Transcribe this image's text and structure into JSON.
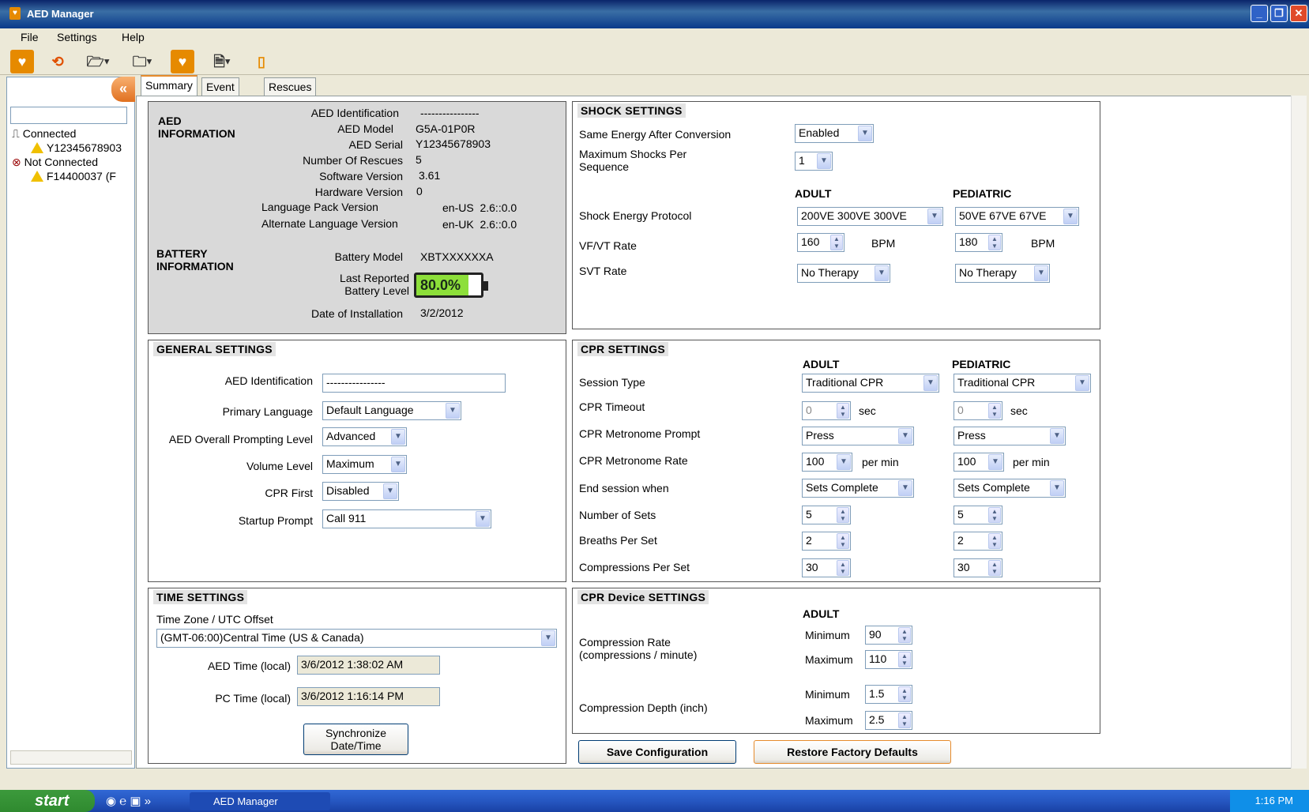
{
  "window": {
    "title": "AED Manager"
  },
  "menu": [
    "File",
    "Settings",
    "Help"
  ],
  "tree": {
    "connected_label": "Connected",
    "connected_device": "Y12345678903",
    "not_connected_label": "Not Connected",
    "not_connected_device": "F14400037 (F"
  },
  "tabs": [
    "Summary",
    "Event Log",
    "Rescues"
  ],
  "aed_info": {
    "title": "AED INFORMATION",
    "identification_label": "AED Identification",
    "identification": "----------------",
    "model_label": "AED Model",
    "model": "G5A-01P0R",
    "serial_label": "AED Serial",
    "serial": "Y12345678903",
    "rescues_label": "Number Of Rescues",
    "rescues": "5",
    "software_label": "Software Version",
    "software": "3.61",
    "hardware_label": "Hardware Version",
    "hardware": "0",
    "langpack_label": "Language Pack Version",
    "langpack": "en-US  2.6::0.0",
    "altlang_label": "Alternate Language Version",
    "altlang": "en-UK  2.6::0.0"
  },
  "battery": {
    "title": "BATTERY INFORMATION",
    "model_label": "Battery Model",
    "model": "XBTXXXXXXA",
    "level_label": "Last Reported Battery Level",
    "level_text": "80.0%",
    "level_fraction": 0.8,
    "install_label": "Date of Installation",
    "install": "3/2/2012"
  },
  "general": {
    "title": "GENERAL SETTINGS",
    "aed_id_label": "AED Identification",
    "aed_id": "----------------",
    "language_label": "Primary Language",
    "language": "Default Language",
    "prompting_label": "AED Overall Prompting Level",
    "prompting": "Advanced",
    "volume_label": "Volume Level",
    "volume": "Maximum",
    "cpr_first_label": "CPR First",
    "cpr_first": "Disabled",
    "startup_label": "Startup Prompt",
    "startup": "Call 911"
  },
  "time": {
    "title": "TIME SETTINGS",
    "tz_label": "Time Zone / UTC Offset",
    "tz": "(GMT-06:00)Central Time (US & Canada)",
    "aed_time_label": "AED Time (local)",
    "aed_time": "3/6/2012 1:38:02 AM",
    "pc_time_label": "PC Time (local)",
    "pc_time": "3/6/2012 1:16:14 PM",
    "sync_button": "Synchronize Date/Time"
  },
  "shock": {
    "title": "SHOCK SETTINGS",
    "same_energy_label": "Same Energy After Conversion",
    "same_energy": "Enabled",
    "max_shocks_label": "Maximum Shocks Per Sequence",
    "max_shocks": "1",
    "adult_header": "ADULT",
    "ped_header": "PEDIATRIC",
    "protocol_label": "Shock Energy Protocol",
    "adult_protocol": "200VE 300VE 300VE",
    "ped_protocol": "50VE 67VE 67VE",
    "vfvt_label": "VF/VT Rate",
    "adult_vfvt": "160",
    "ped_vfvt": "180",
    "bpm": "BPM",
    "svt_label": "SVT Rate",
    "adult_svt": "No Therapy",
    "ped_svt": "No Therapy"
  },
  "cpr": {
    "title": "CPR SETTINGS",
    "adult_header": "ADULT",
    "ped_header": "PEDIATRIC",
    "session_label": "Session Type",
    "adult_session": "Traditional CPR",
    "ped_session": "Traditional CPR",
    "timeout_label": "CPR Timeout",
    "adult_timeout": "0",
    "ped_timeout": "0",
    "sec": "sec",
    "metro_prompt_label": "CPR Metronome Prompt",
    "adult_metro": "Press",
    "ped_metro": "Press",
    "metro_rate_label": "CPR Metronome Rate",
    "adult_rate": "100",
    "ped_rate": "100",
    "per_min": "per min",
    "end_label": "End session when",
    "adult_end": "Sets Complete",
    "ped_end": "Sets Complete",
    "sets_label": "Number of Sets",
    "adult_sets": "5",
    "ped_sets": "5",
    "breaths_label": "Breaths Per Set",
    "adult_breaths": "2",
    "ped_breaths": "2",
    "comp_label": "Compressions Per Set",
    "adult_comp": "30",
    "ped_comp": "30"
  },
  "cpr_device": {
    "title": "CPR Device SETTINGS",
    "adult_header": "ADULT",
    "rate_label": "Compression Rate (compressions / minute)",
    "depth_label": "Compression Depth (inch)",
    "min_label": "Minimum",
    "max_label": "Maximum",
    "rate_min": "90",
    "rate_max": "110",
    "depth_min": "1.5",
    "depth_max": "2.5"
  },
  "buttons": {
    "save": "Save Configuration",
    "restore": "Restore Factory Defaults"
  },
  "taskbar": {
    "start": "start",
    "item": "AED Manager",
    "clock": "1:16 PM"
  }
}
